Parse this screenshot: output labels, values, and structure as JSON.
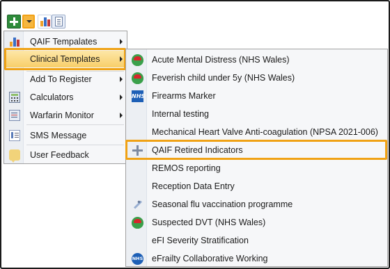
{
  "toolbar": {
    "buttons": [
      {
        "name": "add-icon"
      },
      {
        "name": "dropdown-chevron-icon"
      },
      {
        "name": "bar-chart-icon"
      },
      {
        "name": "document-icon"
      }
    ]
  },
  "menu": {
    "items": [
      {
        "label": "QAIF Tempalates",
        "icon": "bar-chart-icon",
        "has_submenu": true
      },
      {
        "label": "Clinical Templates",
        "icon": "",
        "has_submenu": true,
        "selected": true
      },
      {
        "label": "Add To Register",
        "icon": "",
        "has_submenu": true
      },
      {
        "label": "Calculators",
        "icon": "calculator-icon",
        "has_submenu": true
      },
      {
        "label": "Warfarin Monitor",
        "icon": "warfarin-chart-icon",
        "has_submenu": true
      },
      {
        "label": "SMS Message",
        "icon": "sms-icon",
        "has_submenu": false
      },
      {
        "label": "User Feedback",
        "icon": "feedback-icon",
        "has_submenu": false
      }
    ]
  },
  "submenu": {
    "items": [
      {
        "label": "Acute Mental Distress (NHS Wales)",
        "icon": "nhs-wales-icon"
      },
      {
        "label": "Feverish child under 5y (NHS Wales)",
        "icon": "nhs-wales-icon"
      },
      {
        "label": "Firearms Marker",
        "icon": "nhs-icon",
        "icon_text": "NHS"
      },
      {
        "label": "Internal testing",
        "icon": ""
      },
      {
        "label": "Mechanical Heart Valve Anti-coagulation (NPSA 2021-006)",
        "icon": ""
      },
      {
        "label": "QAIF Retired Indicators",
        "icon": "move-arrows-icon",
        "highlighted": true
      },
      {
        "label": "REMOS reporting",
        "icon": ""
      },
      {
        "label": "Reception Data Entry",
        "icon": ""
      },
      {
        "label": "Seasonal flu vaccination programme",
        "icon": "syringe-icon"
      },
      {
        "label": "Suspected DVT (NHS Wales)",
        "icon": "nhs-wales-icon"
      },
      {
        "label": "eFI Severity Stratification",
        "icon": ""
      },
      {
        "label": "eFrailty Collaborative Working",
        "icon": "nhs-round-icon",
        "icon_text": "NHS"
      }
    ]
  },
  "colors": {
    "highlight_border": "#f0a215",
    "selected_fill": "#f8cf69",
    "menu_background": "#f6f7f9"
  }
}
